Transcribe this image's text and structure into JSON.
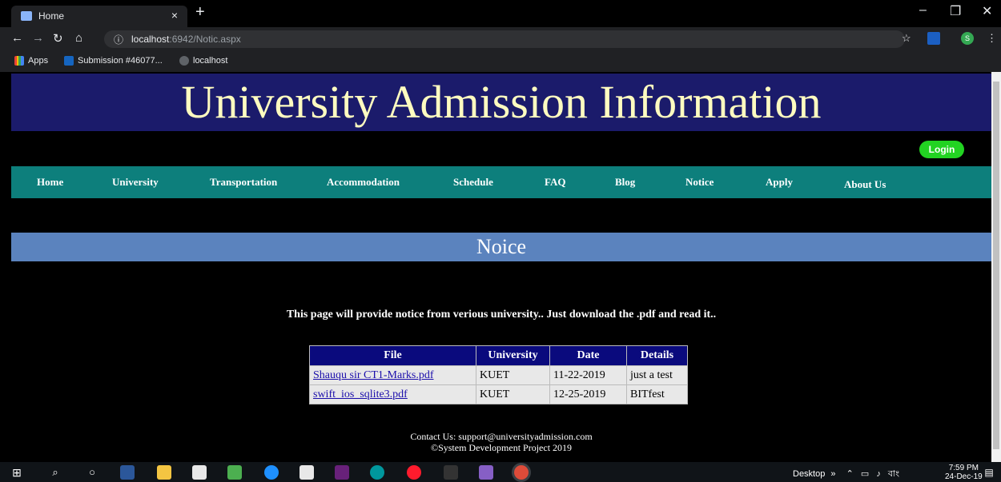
{
  "browser": {
    "tab_title": "Home",
    "tab_close": "×",
    "new_tab": "+",
    "url_host": "localhost",
    "url_path": ":6942/Notic.aspx",
    "bookmarks": [
      {
        "label": "Apps"
      },
      {
        "label": "Submission #46077..."
      },
      {
        "label": "localhost"
      }
    ],
    "profile_initial": "S"
  },
  "site": {
    "banner_title": "University Admission Information",
    "login_label": "Login",
    "nav": [
      "Home",
      "University",
      "Transportation",
      "Accommodation",
      "Schedule",
      "FAQ",
      "Blog",
      "Notice",
      "Apply",
      "About Us"
    ],
    "section_title": "Noice",
    "intro": "This page will provide notice from verious university.. Just download the .pdf and read it..",
    "table": {
      "headers": [
        "File",
        "University",
        "Date",
        "Details"
      ],
      "rows": [
        {
          "file": "Shauqu sir CT1-Marks.pdf",
          "university": "KUET",
          "date": "11-22-2019",
          "details": "just a test"
        },
        {
          "file": "swift_ios_sqlite3.pdf",
          "university": "KUET",
          "date": "12-25-2019",
          "details": "BITfest"
        }
      ]
    },
    "footer_contact": "Contact Us: support@universityadmission.com",
    "footer_copyright": "©System Development Project 2019"
  },
  "taskbar": {
    "desktop_label": "Desktop",
    "chevron": "»",
    "lang": "বাং",
    "time": "7:59 PM",
    "date": "24-Dec-19"
  },
  "colors": {
    "banner_bg": "#1b1b6b",
    "banner_text": "#fffcc0",
    "nav_bg": "#0d7f7c",
    "section_bg": "#5b83be",
    "login_bg": "#22d322",
    "table_header_bg": "#0a0a7d"
  }
}
